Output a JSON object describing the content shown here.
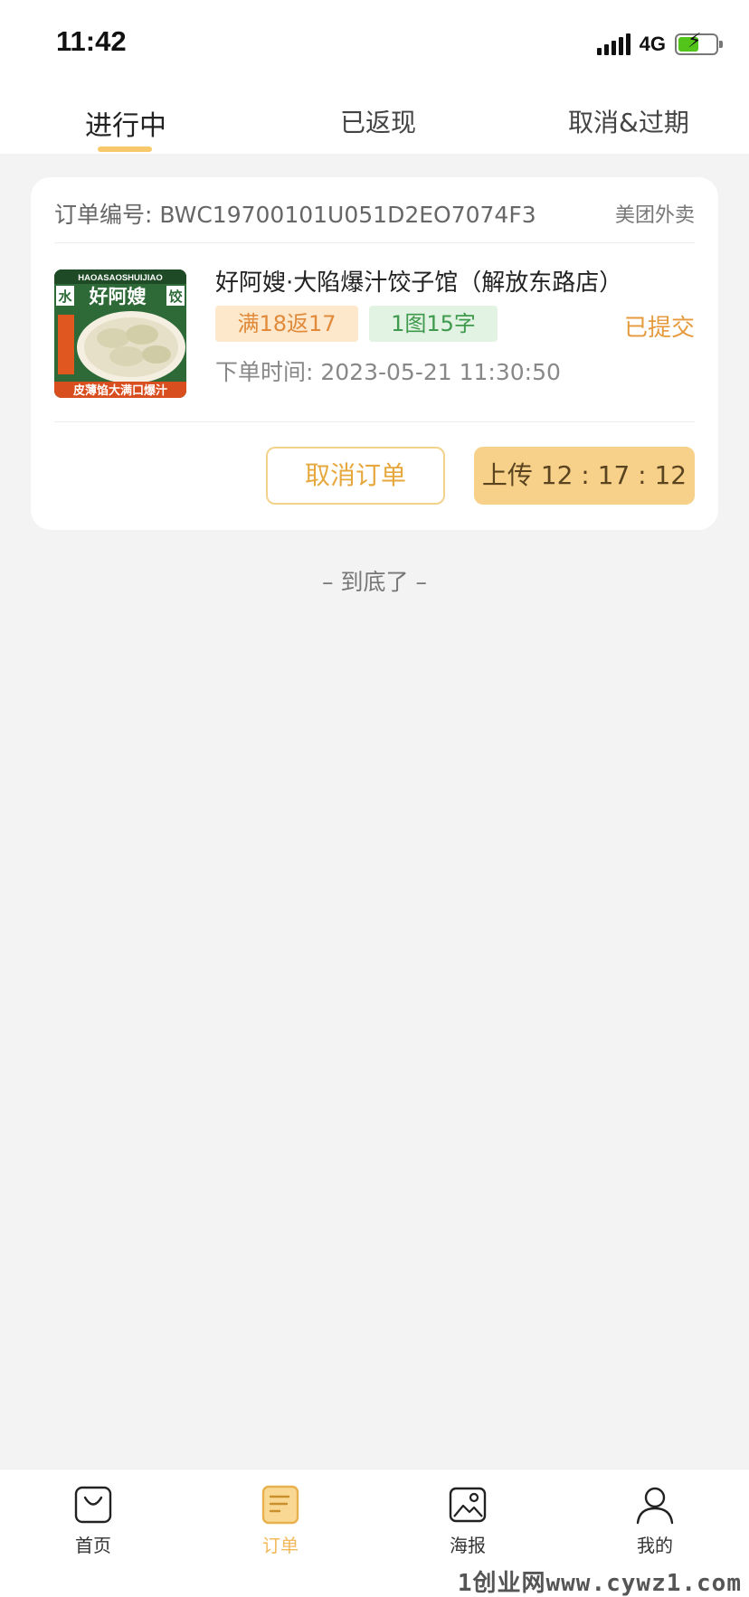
{
  "status_bar": {
    "time": "11:42",
    "network": "4G"
  },
  "tabs": [
    {
      "label": "进行中",
      "active": true
    },
    {
      "label": "已返现",
      "active": false
    },
    {
      "label": "取消&过期",
      "active": false
    }
  ],
  "order": {
    "order_no": "订单编号: BWC19700101U051D2EO7074F3",
    "platform": "美团外卖",
    "shop_name": "好阿嫂·大陷爆汁饺子馆（解放东路店）",
    "image_text": {
      "top": "HAOASAOSHUIJIAO",
      "brand": "好阿嫂",
      "left": "水",
      "right": "饺",
      "bottom": "皮薄馅大满口爆汁"
    },
    "tags": {
      "rebate": "满18返17",
      "requirement": "1图15字"
    },
    "status": "已提交",
    "order_time": "下单时间: 2023-05-21 11:30:50",
    "cancel_label": "取消订单",
    "upload_label": "上传 12 : 17 : 12"
  },
  "end_text": "– 到底了 –",
  "bottom_nav": [
    {
      "label": "首页",
      "icon": "bag-icon",
      "active": false
    },
    {
      "label": "订单",
      "icon": "order-list-icon",
      "active": true
    },
    {
      "label": "海报",
      "icon": "poster-image-icon",
      "active": false
    },
    {
      "label": "我的",
      "icon": "user-profile-icon",
      "active": false
    }
  ],
  "watermark": "1创业网www.cywz1.com",
  "colors": {
    "accent": "#f7c96b",
    "status": "#e59a3c",
    "rebate_tag": "#fde8cc",
    "requirement_tag": "#e2f3e4"
  }
}
